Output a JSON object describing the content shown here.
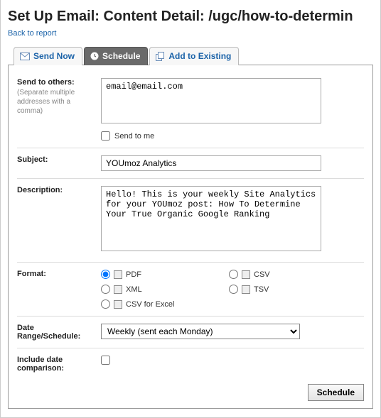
{
  "header": {
    "title": "Set Up Email: Content Detail: /ugc/how-to-determin",
    "back_link": "Back to report"
  },
  "tabs": {
    "send_now": "Send Now",
    "schedule": "Schedule",
    "add_existing": "Add to Existing"
  },
  "labels": {
    "send_to": "Send to others:",
    "send_hint": "(Separate multiple addresses with a comma)",
    "send_to_me": "Send to me",
    "subject": "Subject:",
    "description": "Description:",
    "format": "Format:",
    "date_range": "Date Range/Schedule:",
    "include_comparison": "Include date comparison:"
  },
  "values": {
    "recipients": "email@email.com",
    "subject": "YOUmoz Analytics",
    "description": "Hello! This is your weekly Site Analytics for your YOUmoz post: How To Determine Your True Organic Google Ranking",
    "schedule_option": "Weekly (sent each Monday)"
  },
  "formats": {
    "pdf": "PDF",
    "xml": "XML",
    "csv_excel": "CSV for Excel",
    "csv": "CSV",
    "tsv": "TSV"
  },
  "buttons": {
    "schedule": "Schedule"
  }
}
